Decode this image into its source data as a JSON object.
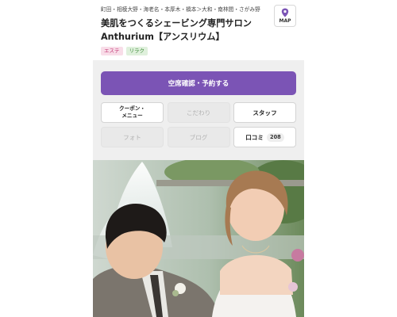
{
  "header": {
    "areas": "町田・相模大野・海老名・本厚木・橋本＞大和・南林間・さがみ野",
    "title": "美肌をつくるシェービング専門サロン　Anthurium【アンスリウム】",
    "tags": [
      "エステ",
      "リラク"
    ],
    "map_label": "MAP",
    "map_icon": "map-pin-icon"
  },
  "actions": {
    "reserve_label": "空席確認・予約する"
  },
  "menu": {
    "coupon_label": "クーポン・\nメニュー",
    "kodawari_label": "こだわり",
    "staff_label": "スタッフ",
    "photo_label": "フォト",
    "blog_label": "ブログ",
    "review_label": "口コミ",
    "review_count": "208"
  },
  "colors": {
    "primary": "#7b54b5",
    "tag_esthe": "#c23574",
    "tag_relax": "#3b8a36",
    "panel_bg": "#efefef"
  }
}
